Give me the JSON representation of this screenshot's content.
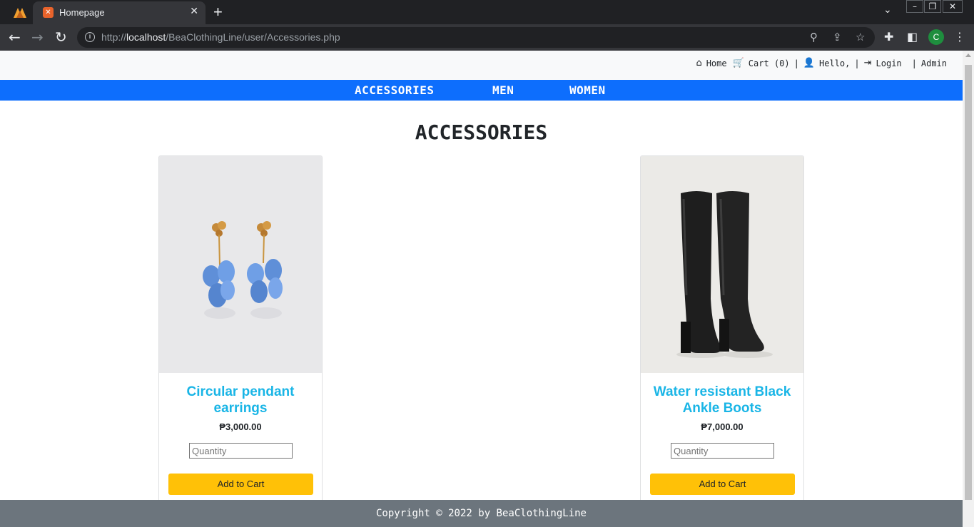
{
  "browser": {
    "tab_title": "Homepage",
    "url_prefix": "http://",
    "url_host": "localhost",
    "url_path": "/BeaClothingLine/user/Accessories.php",
    "profile_initial": "C"
  },
  "topbar": {
    "home": "Home",
    "cart": "Cart (0)",
    "hello": "Hello,",
    "login": "Login",
    "admin": "Admin",
    "separator": "|"
  },
  "categories": [
    "ACCESSORIES",
    "MEN",
    "WOMEN"
  ],
  "page_title": "ACCESSORIES",
  "products": [
    {
      "name": "Circular pendant earrings",
      "price": "₱3,000.00",
      "qty_placeholder": "Quantity",
      "button": "Add to Cart"
    },
    {
      "name": "Water resistant Black Ankle Boots",
      "price": "₱7,000.00",
      "qty_placeholder": "Quantity",
      "button": "Add to Cart"
    }
  ],
  "footer": "Copyright © 2022 by BeaClothingLine",
  "colors": {
    "nav_blue": "#0d6efd",
    "title_cyan": "#19b5e6",
    "button_yellow": "#ffc107",
    "footer_gray": "#6c757d"
  }
}
